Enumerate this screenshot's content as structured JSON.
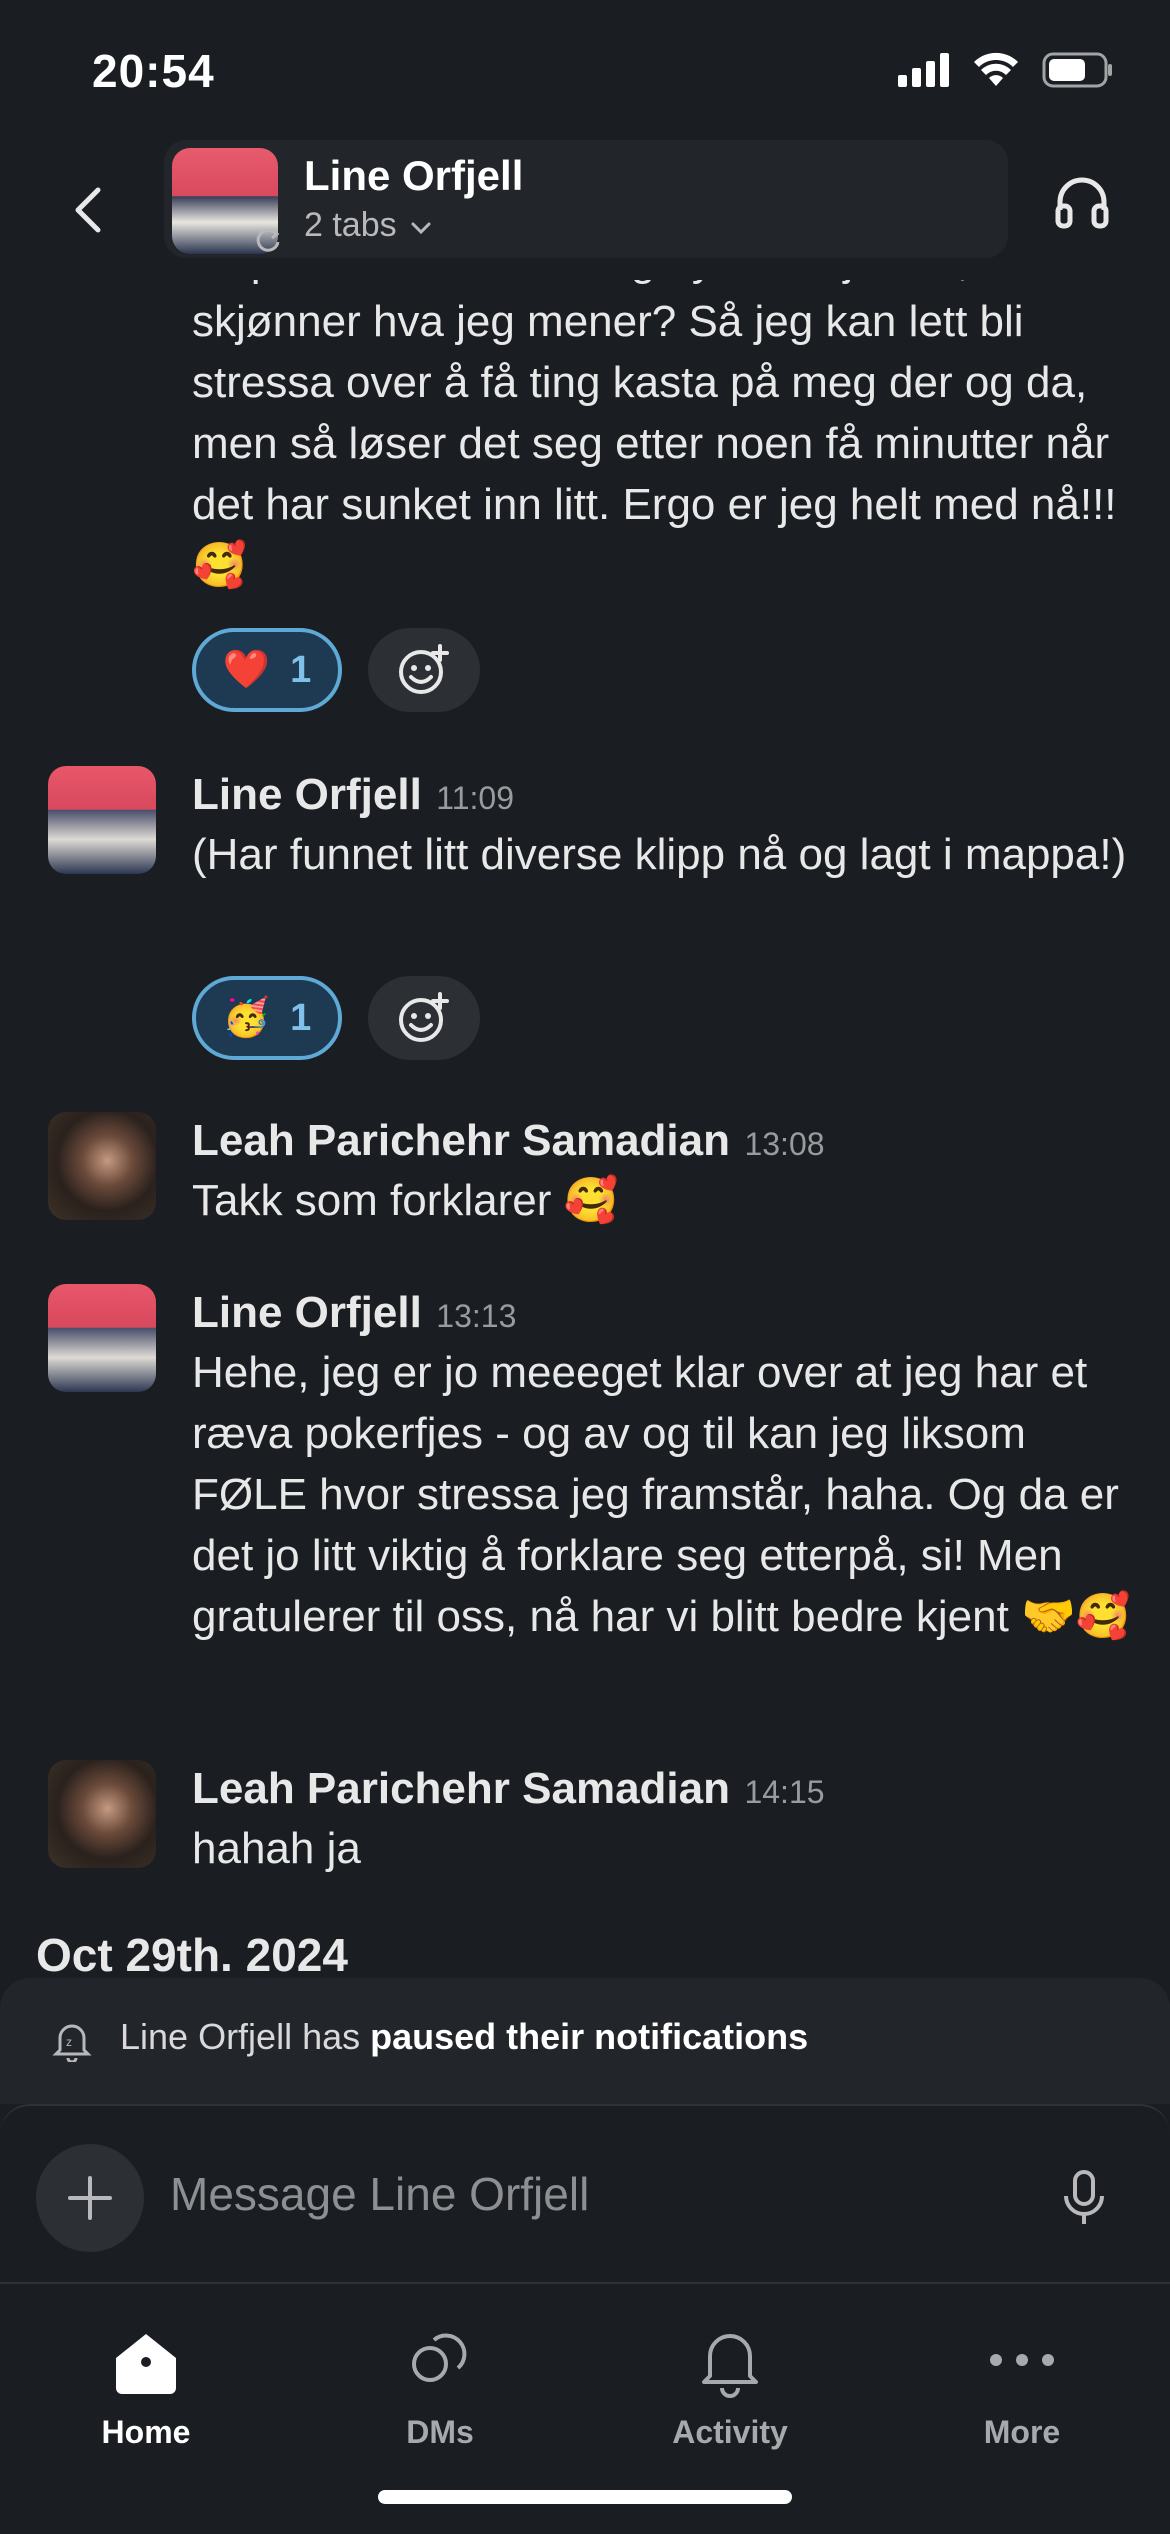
{
  "status": {
    "time": "20:54"
  },
  "header": {
    "title": "Line Orfjell",
    "subtitle": "2 tabs"
  },
  "continuation": {
    "text": "tid på å \"ta innover meg nye beskjeder\", hvis du skjønner hva jeg mener? Så jeg kan lett bli stressa over å få ting kasta på meg der og da, men så løser det seg etter noen få minutter når det har sunket inn litt. Ergo er jeg helt med nå!!! 🥰",
    "reaction": {
      "emoji": "❤️",
      "count": "1"
    }
  },
  "messages": [
    {
      "author": "Line Orfjell",
      "time": "11:09",
      "text": "(Har funnet litt diverse klipp nå og lagt i mappa!)",
      "reaction": {
        "emoji": "🥳",
        "count": "1"
      }
    },
    {
      "author": "Leah Parichehr Samadian",
      "time": "13:08",
      "text": "Takk som forklarer 🥰"
    },
    {
      "author": "Line Orfjell",
      "time": "13:13",
      "text": "Hehe, jeg er jo meeeget klar over at jeg har et ræva pokerfjes - og av og til kan jeg liksom FØLE hvor stressa jeg framstår, haha. Og da er det jo litt viktig å forklare seg etterpå, si! Men gratulerer til oss, nå har vi blitt bedre kjent 🤝🥰"
    },
    {
      "author": "Leah Parichehr Samadian",
      "time": "14:15",
      "text": "hahah ja"
    }
  ],
  "date_separator": "Oct 29th. 2024",
  "notification": {
    "name": "Line Orfjell",
    "middle": " has ",
    "bold": "paused their notifications"
  },
  "composer": {
    "placeholder": "Message Line Orfjell"
  },
  "tabbar": {
    "home": "Home",
    "dms": "DMs",
    "activity": "Activity",
    "more": "More"
  }
}
